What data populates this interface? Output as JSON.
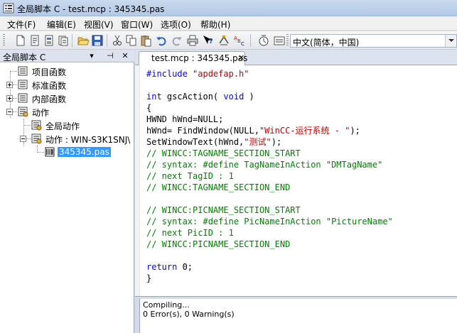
{
  "window": {
    "title": "全局脚本 C - test.mcp : 345345.pas",
    "colors": {
      "selection": "#3399ff",
      "comment": "#008000",
      "keyword": "#0000ff",
      "string": "#c00000"
    }
  },
  "menu": {
    "items": [
      "文件(F)",
      "编辑(E)",
      "视图(V)",
      "窗口(W)",
      "选项(O)",
      "帮助(H)"
    ]
  },
  "toolbar": {
    "icons": [
      "new-file-icon",
      "new-action-icon",
      "edit-icon",
      "open-folder-icon",
      "save-icon",
      "cut-icon",
      "copy-icon",
      "paste-icon",
      "undo-icon",
      "redo-icon",
      "print-icon",
      "help-context-icon",
      "compile-icon",
      "abc-info-icon",
      "trigger-icon",
      "id-icon"
    ],
    "language": {
      "value": "中文(简体，中国)"
    }
  },
  "left_panel": {
    "title": "全局脚本 C",
    "pin": "⊣",
    "close": "✕",
    "tree": [
      {
        "label": "项目函数",
        "expanded": false,
        "has_expander": false
      },
      {
        "label": "标准函数",
        "expanded": false,
        "has_expander": true
      },
      {
        "label": "内部函数",
        "expanded": false,
        "has_expander": true
      },
      {
        "label": "动作",
        "expanded": true,
        "has_expander": true
      },
      {
        "label": "全局动作"
      },
      {
        "label": "动作 : WIN-S3K1SNJ\\"
      },
      {
        "label": "345345.pas",
        "selected": true
      }
    ]
  },
  "editor": {
    "tab": {
      "label": "test.mcp : 345345.pas",
      "close": "✕"
    },
    "code": [
      [
        {
          "t": "#include ",
          "c": "pp"
        },
        {
          "t": "\"apdefap.h\"",
          "c": "str"
        }
      ],
      [],
      [
        {
          "t": "int ",
          "c": "kw"
        },
        {
          "t": "gscAction( ",
          "c": "tx"
        },
        {
          "t": "void",
          "c": "kw"
        },
        {
          "t": " )",
          "c": "tx"
        }
      ],
      [
        {
          "t": "{",
          "c": "tx"
        }
      ],
      [
        {
          "t": "HWND hWnd=NULL;",
          "c": "tx"
        }
      ],
      [
        {
          "t": "hWnd= FindWindow(NULL,",
          "c": "tx"
        },
        {
          "t": "\"WinCC-运行系统 - \"",
          "c": "str"
        },
        {
          "t": ");",
          "c": "tx"
        }
      ],
      [
        {
          "t": "SetWindowText(hWnd,",
          "c": "tx"
        },
        {
          "t": "\"测试\"",
          "c": "str"
        },
        {
          "t": ");",
          "c": "tx"
        }
      ],
      [
        {
          "t": "// WINCC:TAGNAME_SECTION_START",
          "c": "cm"
        }
      ],
      [
        {
          "t": "// syntax: #define TagNameInAction \"DMTagName\"",
          "c": "cm"
        }
      ],
      [
        {
          "t": "// next TagID : 1",
          "c": "cm"
        }
      ],
      [
        {
          "t": "// WINCC:TAGNAME_SECTION_END",
          "c": "cm"
        }
      ],
      [],
      [
        {
          "t": "// WINCC:PICNAME_SECTION_START",
          "c": "cm"
        }
      ],
      [
        {
          "t": "// syntax: #define PicNameInAction \"PictureName\"",
          "c": "cm"
        }
      ],
      [
        {
          "t": "// next PicID : 1",
          "c": "cm"
        }
      ],
      [
        {
          "t": "// WINCC:PICNAME_SECTION_END",
          "c": "cm"
        }
      ],
      [],
      [
        {
          "t": "return ",
          "c": "kw"
        },
        {
          "t": "0;",
          "c": "tx"
        }
      ],
      [
        {
          "t": "}",
          "c": "tx"
        }
      ]
    ]
  },
  "output": {
    "lines": [
      "Compiling...",
      "0 Error(s), 0 Warning(s)"
    ]
  }
}
